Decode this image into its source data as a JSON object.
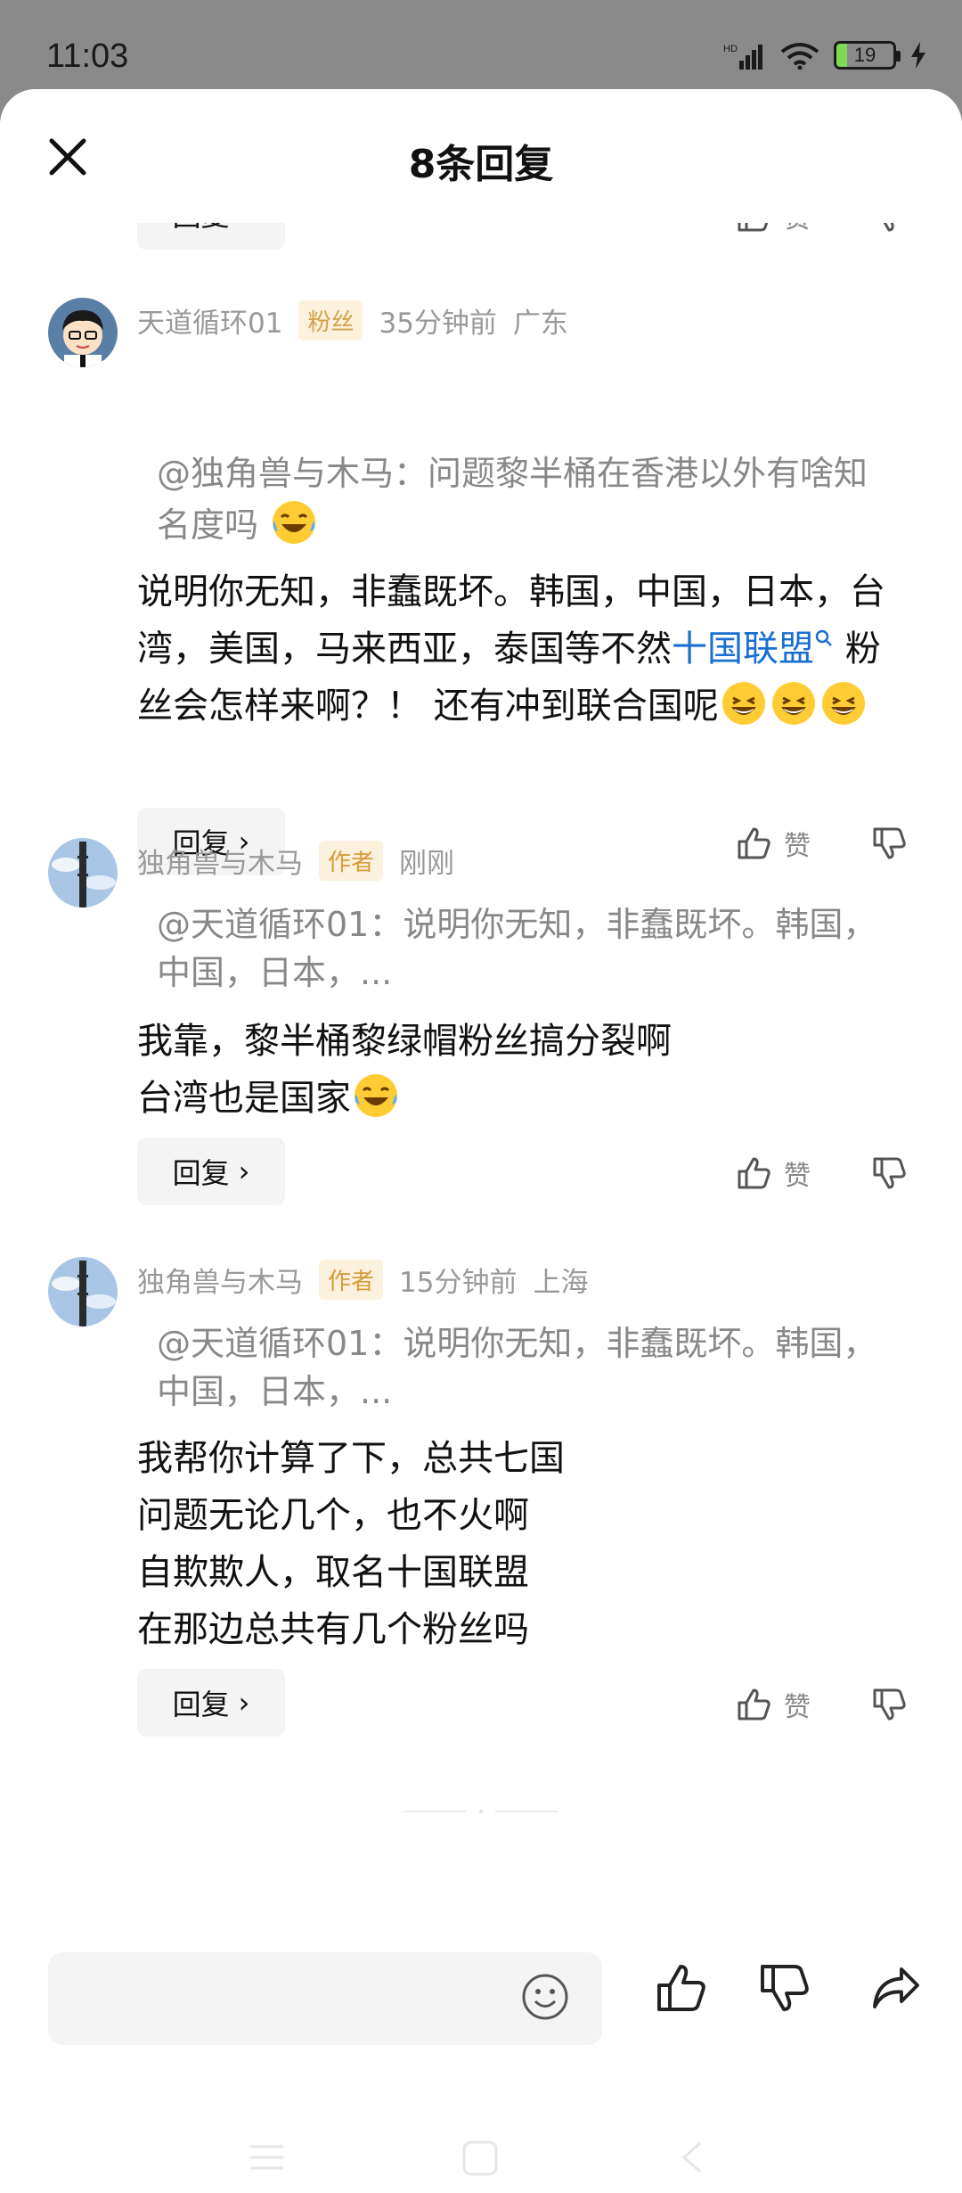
{
  "status": {
    "time": "11:03",
    "battery": "19"
  },
  "header": {
    "title": "8条回复"
  },
  "top_partial": {
    "reply_label": "回复",
    "like_label": "赞"
  },
  "comments": [
    {
      "username": "天道循环01",
      "tag": "粉丝",
      "time": "35分钟前",
      "location": "广东",
      "quote": "@独角兽与木马：问题黎半桶在香港以外有啥知名度吗",
      "content_before_link": "说明你无知，非蠢既坏。韩国，中国，日本，台湾，美国，马来西亚，泰国等不然",
      "link": "十国联盟",
      "content_after_link": "粉丝会怎样来啊？！ 还有冲到联合国呢",
      "reply_label": "回复",
      "like_label": "赞"
    },
    {
      "username": "独角兽与木马",
      "tag": "作者",
      "time": "刚刚",
      "location": "",
      "quote": "@天道循环01：说明你无知，非蠢既坏。韩国，中国，日本，...",
      "content_lines": [
        "我靠，黎半桶黎绿帽粉丝搞分裂啊",
        "台湾也是国家"
      ],
      "reply_label": "回复",
      "like_label": "赞"
    },
    {
      "username": "独角兽与木马",
      "tag": "作者",
      "time": "15分钟前",
      "location": "上海",
      "quote": "@天道循环01：说明你无知，非蠢既坏。韩国，中国，日本，...",
      "content_lines": [
        "我帮你计算了下，总共七国",
        "问题无论几个，也不火啊",
        "自欺欺人，取名十国联盟",
        "在那边总共有几个粉丝吗"
      ],
      "reply_label": "回复",
      "like_label": "赞"
    }
  ],
  "input": {
    "placeholder": ""
  },
  "colors": {
    "link": "#1a6fd1",
    "tag_bg": "#fbf1dc",
    "tag_text": "#d69a3a"
  }
}
